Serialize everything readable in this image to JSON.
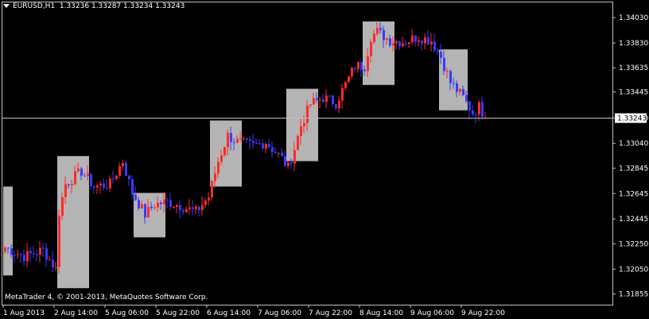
{
  "header": {
    "symbol": "EURUSD,H1",
    "quote": "1.33236 1.33287 1.33234 1.33243"
  },
  "copyright": "MetaTrader 4, © 2001-2013, MetaQuotes Software Corp.",
  "current_price_label": "1.33243",
  "colors": {
    "background": "#000000",
    "up": "#ff2a2a",
    "down": "#3a3aff",
    "box": "#b4b4b4",
    "axis": "#c0c0c0",
    "text": "#ffffff"
  },
  "chart_data": {
    "type": "candlestick",
    "y_ticks": [
      "1.34030",
      "1.33830",
      "1.33635",
      "1.33445",
      "1.33240",
      "1.33040",
      "1.32845",
      "1.32645",
      "1.32445",
      "1.32250",
      "1.32050",
      "1.31855"
    ],
    "x_ticks": [
      "1 Aug 2013",
      "2 Aug 14:00",
      "5 Aug 06:00",
      "5 Aug 22:00",
      "6 Aug 14:00",
      "7 Aug 06:00",
      "7 Aug 22:00",
      "8 Aug 14:00",
      "9 Aug 06:00",
      "9 Aug 22:00"
    ],
    "ylim": [
      1.3177,
      1.3415
    ],
    "current_price": 1.33243,
    "session_boxes": [
      {
        "x_start": 0,
        "x_end": 2,
        "low": 1.32,
        "high": 1.327
      },
      {
        "x_start": 17,
        "x_end": 26,
        "low": 1.319,
        "high": 1.3294
      },
      {
        "x_start": 41,
        "x_end": 50,
        "low": 1.323,
        "high": 1.3265
      },
      {
        "x_start": 65,
        "x_end": 74,
        "low": 1.327,
        "high": 1.3322
      },
      {
        "x_start": 89,
        "x_end": 98,
        "low": 1.329,
        "high": 1.3347
      },
      {
        "x_start": 113,
        "x_end": 122,
        "low": 1.335,
        "high": 1.34
      },
      {
        "x_start": 137,
        "x_end": 145,
        "low": 1.333,
        "high": 1.3378
      }
    ],
    "ohlc": []
  }
}
